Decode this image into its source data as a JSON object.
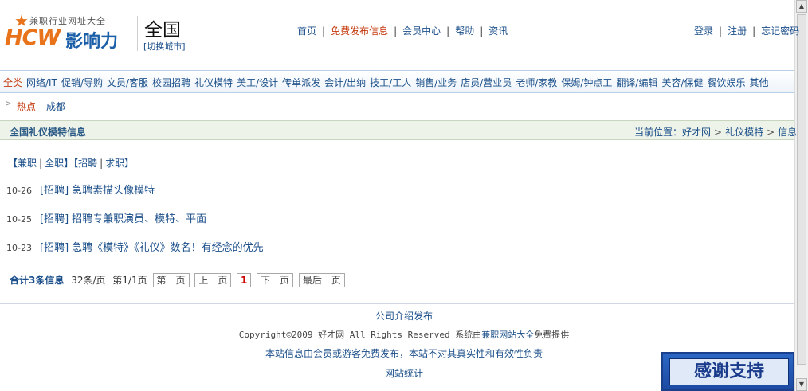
{
  "logo": {
    "tagline": "兼职行业网址大全",
    "brand_en": "HCW",
    "brand_cn": "影响力"
  },
  "city": {
    "name": "全国",
    "switch": "[切换城市]"
  },
  "top_nav": [
    {
      "label": "首页"
    },
    {
      "label": "免费发布信息"
    },
    {
      "label": "会员中心"
    },
    {
      "label": "帮助"
    },
    {
      "label": "资讯"
    }
  ],
  "user_nav": {
    "login": "登录",
    "register": "注册",
    "forgot": "忘记密码"
  },
  "categories": [
    "全类",
    "网络/IT",
    "促销/导购",
    "文员/客服",
    "校园招聘",
    "礼仪模特",
    "美工/设计",
    "传单派发",
    "会计/出纳",
    "技工/工人",
    "销售/业务",
    "店员/营业员",
    "老师/家教",
    "保姆/钟点工",
    "翻译/编辑",
    "美容/保健",
    "餐饮娱乐",
    "其他"
  ],
  "hot": {
    "label": "热点",
    "city": "成都"
  },
  "section": {
    "title": "全国礼仪模特信息",
    "breadcrumb_prefix": "当前位置：",
    "crumbs": [
      "好才网",
      "礼仪模特",
      "信息"
    ]
  },
  "filters": {
    "part_time": "【兼职",
    "full_time": "全职】",
    "hire": "【招聘",
    "seek": "求职】"
  },
  "listings": [
    {
      "date": "10-26",
      "type": "[招聘]",
      "title": "急聘素描头像模特"
    },
    {
      "date": "10-25",
      "type": "[招聘]",
      "title": "招聘专兼职演员、模特、平面"
    },
    {
      "date": "10-23",
      "type": "[招聘]",
      "title": "急聘《模特》《礼仪》数名！有经念的优先"
    }
  ],
  "pager": {
    "total": "合计3条信息",
    "per_page": "32条/页",
    "page_of": "第1/1页",
    "first": "第一页",
    "prev": "上一页",
    "current": "1",
    "next": "下一页",
    "last": "最后一页"
  },
  "footer": {
    "about": "公司介绍发布",
    "copyright": "Copyright©2009 好才网 All Rights Reserved 系统由",
    "copyright_link": "兼职网站大全",
    "copyright_tail": "免费提供",
    "disclaimer": "本站信息由会员或游客免费发布，本站不对其真实性和有效性负责",
    "stats": "网站统计"
  },
  "float_banner": {
    "label": "感谢支持"
  },
  "colors": {
    "link": "#1b4f8a",
    "accent": "#c4380c",
    "logo_orange": "#e8731a",
    "logo_blue": "#1b5fa8"
  }
}
